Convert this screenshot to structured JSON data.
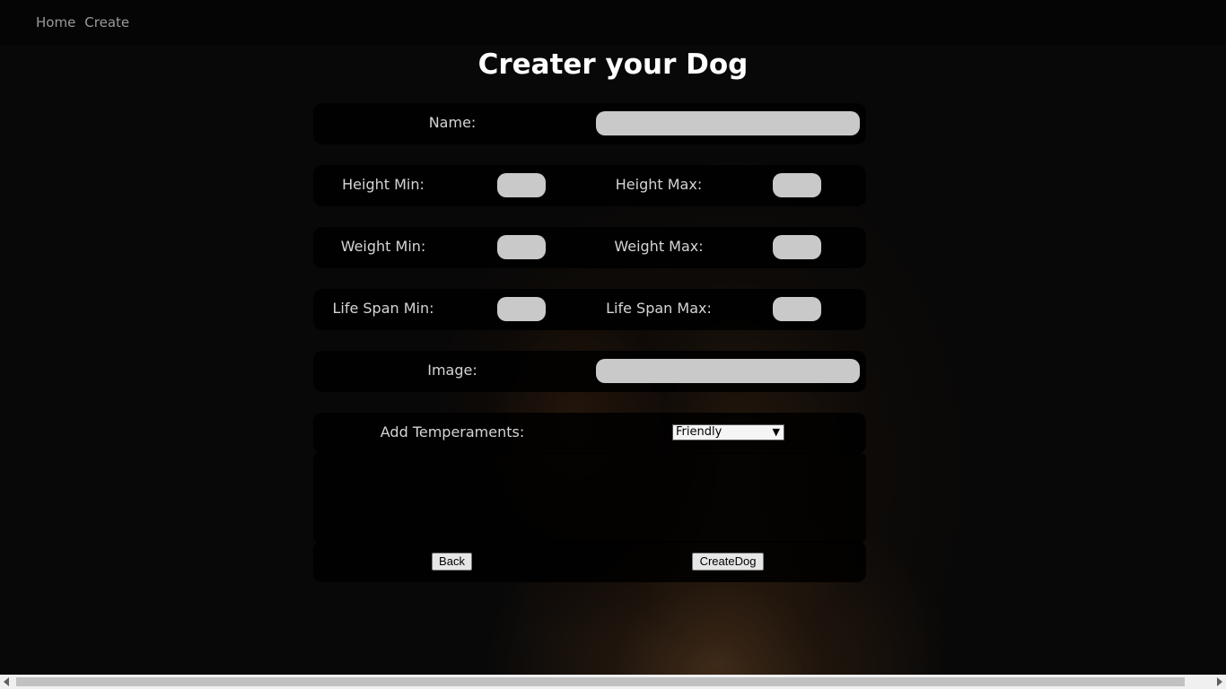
{
  "nav": {
    "home": "Home",
    "create": "Create"
  },
  "title": "Creater your Dog",
  "form": {
    "name_label": "Name:",
    "name_value": "",
    "height_min_label": "Height Min:",
    "height_max_label": "Height Max:",
    "weight_min_label": "Weight Min:",
    "weight_max_label": "Weight Max:",
    "lifespan_min_label": "Life Span Min:",
    "lifespan_max_label": "Life Span Max:",
    "image_label": "Image:",
    "temperaments_label": "Add Temperaments:",
    "temperament_selected": "Friendly",
    "back_button": "Back",
    "create_button": "CreateDog"
  },
  "icons": {
    "select_chevron": "chevron-down-icon"
  }
}
